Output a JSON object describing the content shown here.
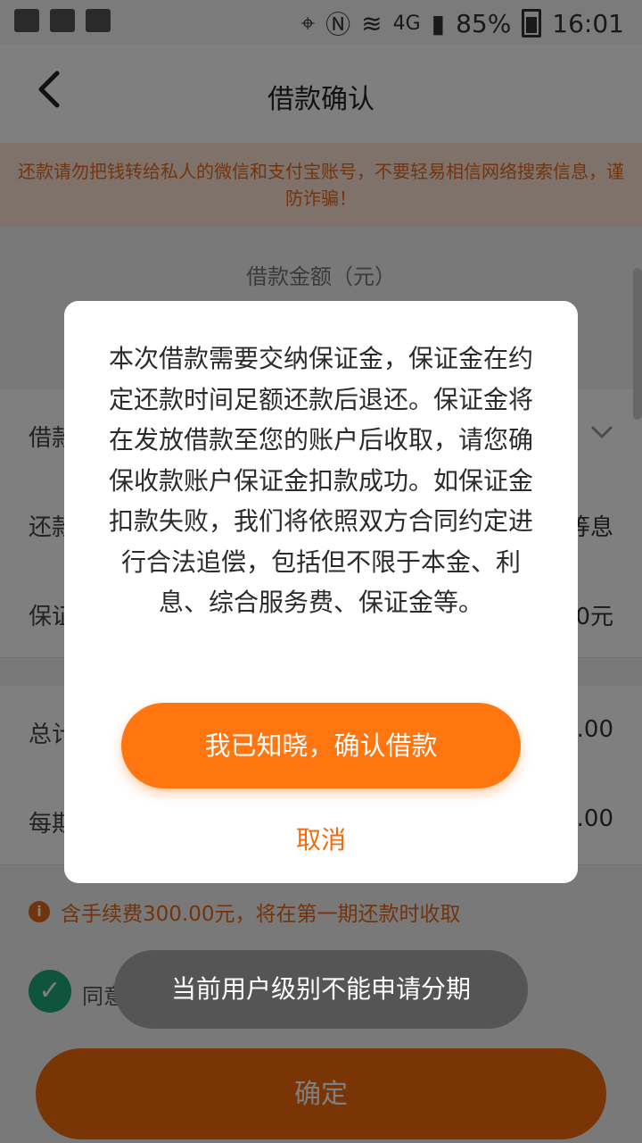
{
  "status_bar": {
    "icons_left": [
      "gallery-icon",
      "baidu-paw-icon",
      "calendar-icon"
    ],
    "battery_percent": "85%",
    "time": "16:01",
    "network": "4G"
  },
  "header": {
    "title": "借款确认"
  },
  "notice": {
    "text": "还款请勿把钱转给私人的微信和支付宝账号，不要轻易相信网络搜索信息，谨防诈骗！"
  },
  "form": {
    "amount_label": "借款金额（元）",
    "rows": [
      {
        "label_visible": "借款",
        "value_visible": ""
      },
      {
        "label_visible": "还款",
        "value_visible": "等息"
      },
      {
        "label_visible": "保证",
        "value_visible": "0元"
      },
      {
        "label_visible": "总计",
        "value_visible": ".00"
      },
      {
        "label_visible": "每期",
        "value_visible": ".00"
      }
    ],
    "fee_note": "含手续费300.00元，将在第一期还款时收取",
    "agree_text_visible": "同意",
    "confirm_label": "确定"
  },
  "dialog": {
    "message": "本次借款需要交纳保证金，保证金在约定还款时间足额还款后退还。保证金将在发放借款至您的账户后收取，请您确保收款账户保证金扣款成功。如保证金扣款失败，我们将依照双方合同约定进行合法追偿，包括但不限于本金、利息、综合服务费、保证金等。",
    "primary_label": "我已知晓，确认借款",
    "cancel_label": "取消"
  },
  "toast": {
    "text": "当前用户级别不能申请分期"
  },
  "colors": {
    "accent": "#f26b0c",
    "notice_bg": "#fde5d6",
    "check_green": "#1fa87a"
  }
}
